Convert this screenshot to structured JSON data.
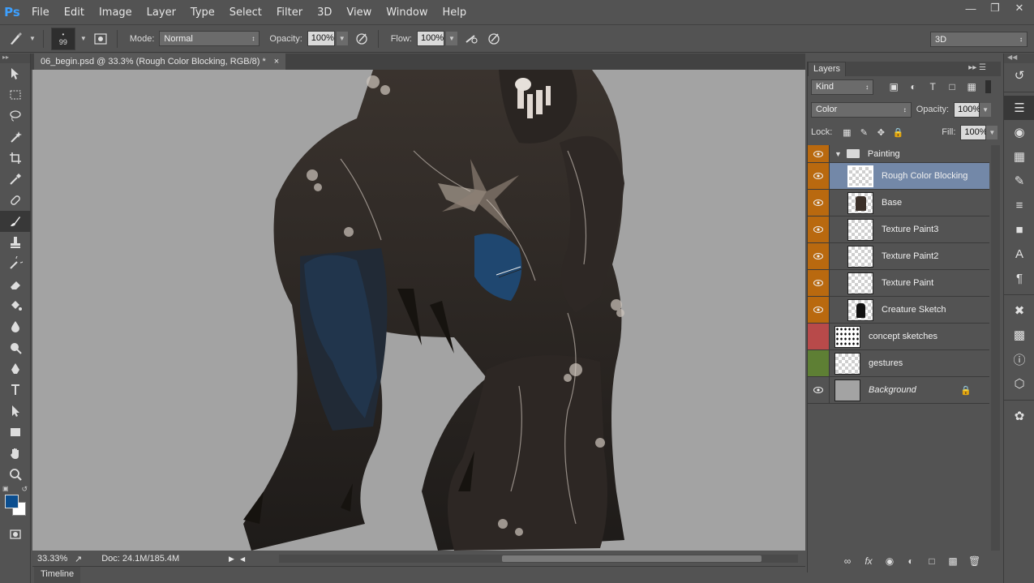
{
  "app": {
    "logo": "Ps"
  },
  "menu": [
    "File",
    "Edit",
    "Image",
    "Layer",
    "Type",
    "Select",
    "Filter",
    "3D",
    "View",
    "Window",
    "Help"
  ],
  "options": {
    "brush_size": "99",
    "mode_label": "Mode:",
    "mode_value": "Normal",
    "opacity_label": "Opacity:",
    "opacity_value": "100%",
    "flow_label": "Flow:",
    "flow_value": "100%",
    "workspace": "3D"
  },
  "document": {
    "tab_title": "06_begin.psd @ 33.3% (Rough Color Blocking, RGB/8) *",
    "close": "×"
  },
  "status": {
    "zoom": "33.33%",
    "doc_info": "Doc: 24.1M/185.4M"
  },
  "timeline": {
    "label": "Timeline"
  },
  "layers_panel": {
    "tab": "Layers",
    "filter_kind": "Kind",
    "blend_mode": "Color",
    "opacity_label": "Opacity:",
    "opacity_value": "100%",
    "lock_label": "Lock:",
    "fill_label": "Fill:",
    "fill_value": "100%",
    "group_name": "Painting",
    "layers": [
      {
        "name": "Rough Color Blocking"
      },
      {
        "name": "Base"
      },
      {
        "name": "Texture Paint3"
      },
      {
        "name": "Texture Paint2"
      },
      {
        "name": "Texture Paint"
      },
      {
        "name": "Creature Sketch"
      },
      {
        "name": "concept sketches"
      },
      {
        "name": "gestures"
      },
      {
        "name": "Background"
      }
    ]
  },
  "colors": {
    "foreground": "#0b4e8f",
    "background": "#ffffff",
    "selected_layer": "#7388a8",
    "label_orange": "#b9690f",
    "label_red": "#b84a4a",
    "label_green": "#5e7f34",
    "canvas_bg": "#a3a3a3"
  }
}
